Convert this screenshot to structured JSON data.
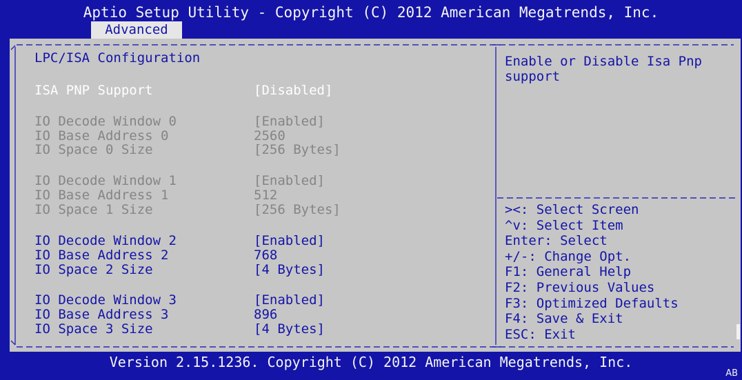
{
  "header": {
    "title": "Aptio Setup Utility - Copyright (C) 2012 American Megatrends, Inc.",
    "active_tab": "Advanced"
  },
  "main": {
    "section_title": "LPC/ISA Configuration",
    "settings": [
      {
        "label": "ISA PNP Support",
        "value": "[Disabled]",
        "state": "selected"
      },
      {
        "label": "IO Decode Window 0",
        "value": "[Enabled]",
        "state": "disabled"
      },
      {
        "label": "IO Base Address 0",
        "value": "2560",
        "state": "disabled"
      },
      {
        "label": "IO Space 0 Size",
        "value": "[256 Bytes]",
        "state": "disabled"
      },
      {
        "label": "IO Decode Window 1",
        "value": "[Enabled]",
        "state": "disabled"
      },
      {
        "label": "IO Base Address 1",
        "value": "512",
        "state": "disabled"
      },
      {
        "label": "IO Space 1 Size",
        "value": "[256 Bytes]",
        "state": "disabled"
      },
      {
        "label": "IO Decode Window 2",
        "value": "[Enabled]",
        "state": "enabled"
      },
      {
        "label": "IO Base Address 2",
        "value": "768",
        "state": "enabled"
      },
      {
        "label": "IO Space 2 Size",
        "value": "[4 Bytes]",
        "state": "enabled"
      },
      {
        "label": "IO Decode Window 3",
        "value": "[Enabled]",
        "state": "enabled"
      },
      {
        "label": "IO Base Address 3",
        "value": "896",
        "state": "enabled"
      },
      {
        "label": "IO Space 3 Size",
        "value": "[4 Bytes]",
        "state": "enabled"
      }
    ]
  },
  "help": {
    "description": "Enable or Disable Isa Pnp support",
    "keys": [
      "><: Select Screen",
      "^v: Select Item",
      "Enter: Select",
      "+/-: Change Opt.",
      "F1: General Help",
      "F2: Previous Values",
      "F3: Optimized Defaults",
      "F4: Save & Exit",
      "ESC: Exit"
    ]
  },
  "footer": {
    "version_text": "Version 2.15.1236. Copyright (C) 2012 American Megatrends, Inc.",
    "badge": "AB"
  },
  "colors": {
    "background": "#1414a8",
    "panel": "#c6c6c6",
    "text_active": "#1414a8",
    "text_disabled": "#858585",
    "text_selected": "#ffffff"
  }
}
